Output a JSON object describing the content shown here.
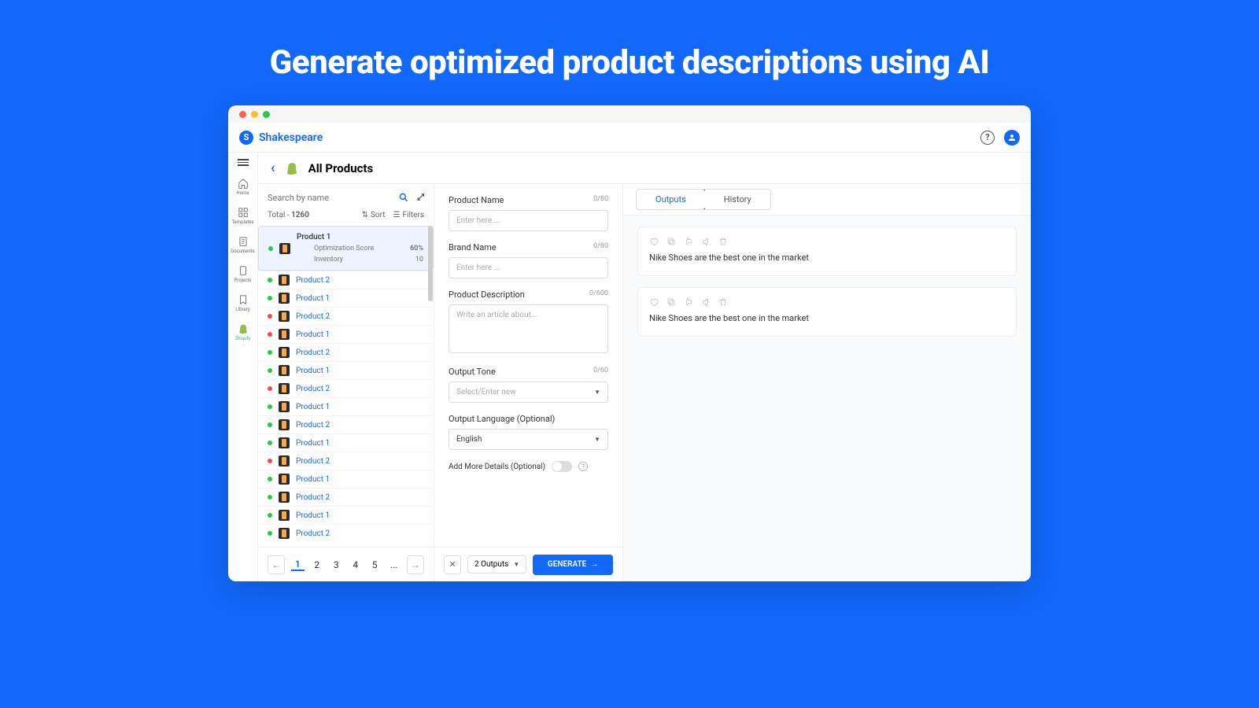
{
  "hero": "Generate optimized product descriptions using AI",
  "brand": "Shakespeare",
  "sidebar": {
    "items": [
      {
        "label": "Home"
      },
      {
        "label": "Templates"
      },
      {
        "label": "Documents"
      },
      {
        "label": "Projects"
      },
      {
        "label": "Library"
      },
      {
        "label": "Shopify"
      }
    ]
  },
  "page": {
    "title": "All Products"
  },
  "list": {
    "search_placeholder": "Search by name",
    "total_label": "Total - ",
    "total_value": "1260",
    "sort_label": "Sort",
    "filters_label": "Filters",
    "selected": {
      "name": "Product 1",
      "opt_label": "Optimization Score",
      "opt_value": "60%",
      "inv_label": "Inventory",
      "inv_value": "10"
    },
    "items": [
      {
        "name": "Product 2",
        "status": "g"
      },
      {
        "name": "Product 1",
        "status": "g"
      },
      {
        "name": "Product 2",
        "status": "r"
      },
      {
        "name": "Product 1",
        "status": "r"
      },
      {
        "name": "Product 2",
        "status": "g"
      },
      {
        "name": "Product 1",
        "status": "g"
      },
      {
        "name": "Product 2",
        "status": "r"
      },
      {
        "name": "Product 1",
        "status": "g"
      },
      {
        "name": "Product 2",
        "status": "g"
      },
      {
        "name": "Product 1",
        "status": "g"
      },
      {
        "name": "Product 2",
        "status": "r"
      },
      {
        "name": "Product 1",
        "status": "g"
      },
      {
        "name": "Product 2",
        "status": "g"
      },
      {
        "name": "Product 1",
        "status": "g"
      },
      {
        "name": "Product 2",
        "status": "g"
      }
    ],
    "pages": [
      "1",
      "2",
      "3",
      "4",
      "5",
      "..."
    ]
  },
  "form": {
    "pn_label": "Product Name",
    "pn_limit": "0/80",
    "pn_ph": "Enter here ...",
    "bn_label": "Brand Name",
    "bn_limit": "0/80",
    "bn_ph": "Enter here ...",
    "pd_label": "Product Description",
    "pd_limit": "0/600",
    "pd_ph": "Write an article about...",
    "tone_label": "Output Tone",
    "tone_limit": "0/60",
    "tone_ph": "Select/Enter new",
    "lang_label": "Output Language (Optional)",
    "lang_value": "English",
    "more_label": "Add More Details (Optional)",
    "outputs_sel": "2 Outputs",
    "gen_label": "GENERATE"
  },
  "tabs": {
    "outputs": "Outputs",
    "history": "History"
  },
  "outputs": [
    {
      "text": "Nike Shoes are the best one in the market"
    },
    {
      "text": "Nike Shoes are the best one in the market"
    }
  ]
}
